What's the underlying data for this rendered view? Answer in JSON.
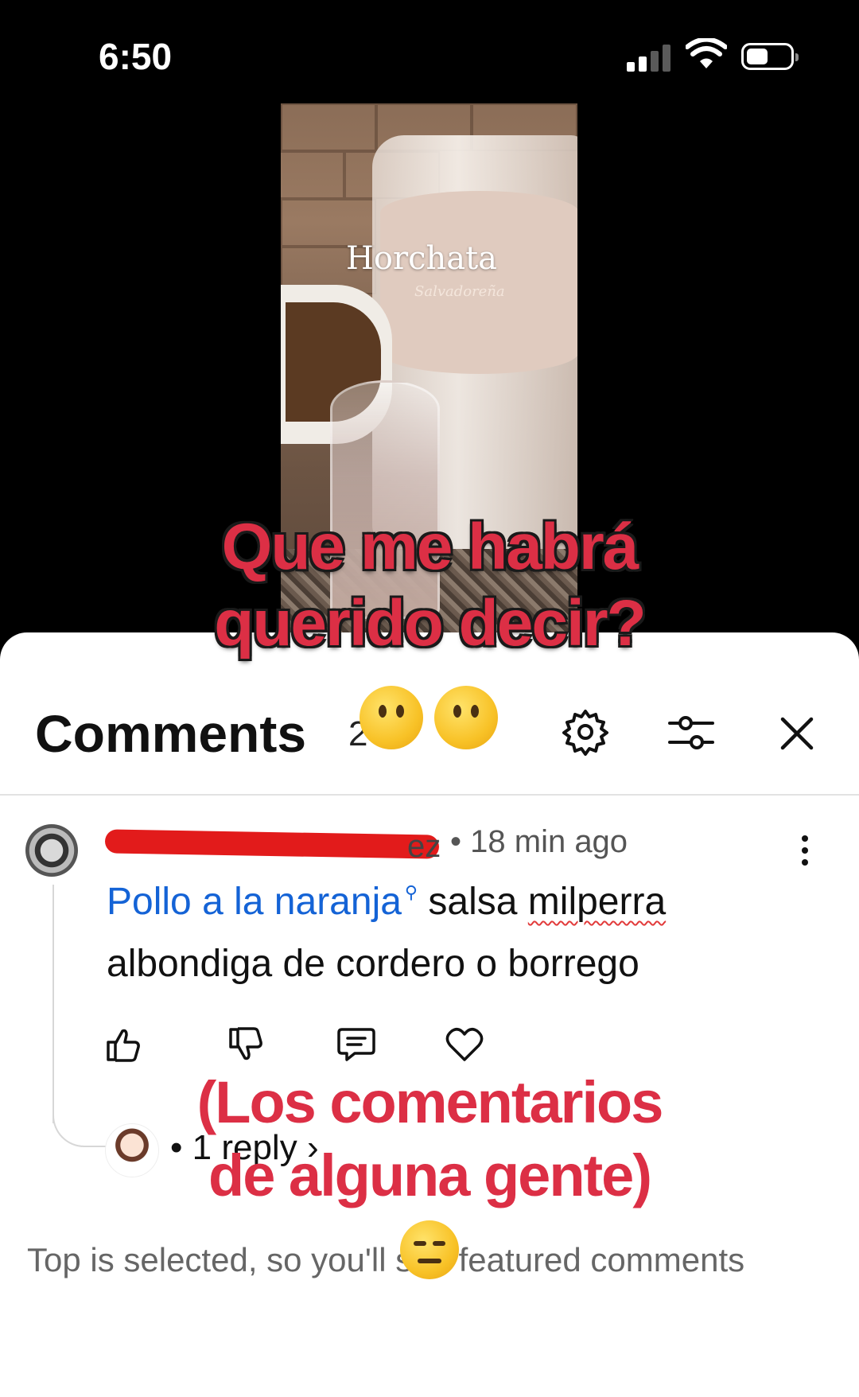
{
  "status_bar": {
    "time": "6:50"
  },
  "video": {
    "title": "Horchata",
    "subtitle": "Salvadoreña"
  },
  "overlay": {
    "caption_top_line1": "Que me habrá",
    "caption_top_line2": "querido decir?",
    "caption_bottom_line1": "(Los comentarios",
    "caption_bottom_line2": "de alguna gente)"
  },
  "comments": {
    "title": "Comments",
    "count_partial": "2",
    "items": [
      {
        "author_tail": "ez",
        "separator": "•",
        "time": "18 min ago",
        "link_text": "Pollo a la naranja",
        "text_after_link_1": "salsa",
        "text_after_link_2": "milperra",
        "text_line2": "albondiga de cordero o borrego",
        "replies": "1 reply",
        "replies_chevron": "›"
      }
    ],
    "footer_note": "Top is selected, so you'll see featured comments"
  },
  "icons": {
    "settings": "gear-icon",
    "filter": "sliders-icon",
    "close": "close-icon",
    "more": "more-vertical-icon",
    "like": "thumbs-up-icon",
    "dislike": "thumbs-down-icon",
    "reply": "comment-icon",
    "heart": "heart-icon"
  },
  "colors": {
    "caption_red": "#dc2f45",
    "link_blue": "#1463d6"
  }
}
